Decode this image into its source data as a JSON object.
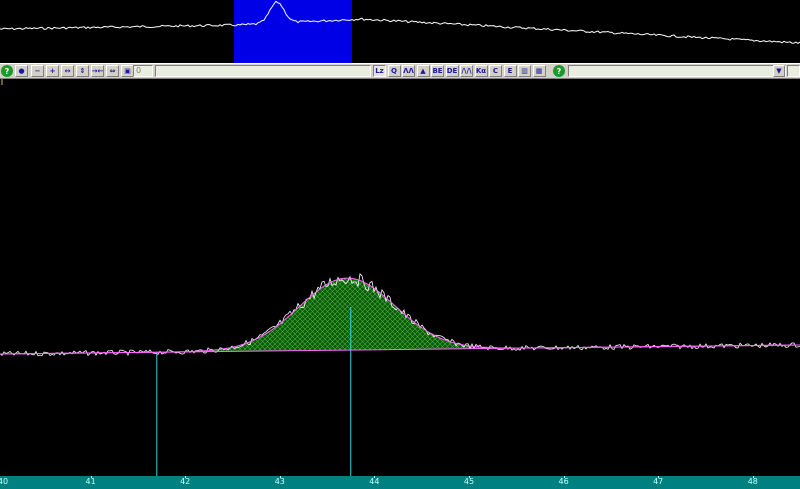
{
  "overview": {
    "selection_color": "#0000e6",
    "trace_color": "#ffffff"
  },
  "toolbar": {
    "help_glyph": "?",
    "stop_glyph": "●",
    "value_field": "0",
    "range_glyph": "▼",
    "buttons": [
      {
        "name": "minus-button",
        "glyph": "−"
      },
      {
        "name": "plus-button",
        "glyph": "+"
      },
      {
        "name": "zoom-x-out-button",
        "glyph": "↔"
      },
      {
        "name": "zoom-y-out-button",
        "glyph": "⇕"
      },
      {
        "name": "zoom-x-in-button",
        "glyph": "→←"
      },
      {
        "name": "zoom-y-in-button",
        "glyph": "⇔"
      },
      {
        "name": "full-view-button",
        "glyph": "▣"
      }
    ],
    "tools": [
      {
        "name": "cursor-tool-button",
        "glyph": "Lz"
      },
      {
        "name": "zoom-tool-button",
        "glyph": "Q"
      },
      {
        "name": "peak-tool-button",
        "glyph": "ΛΛ"
      },
      {
        "name": "area-tool-button",
        "glyph": "▲"
      },
      {
        "name": "be-tool-button",
        "glyph": "BE"
      },
      {
        "name": "de-tool-button",
        "glyph": "DE"
      },
      {
        "name": "fit-tool-button",
        "glyph": "/\\/\\"
      },
      {
        "name": "ka-tool-button",
        "glyph": "Kα"
      },
      {
        "name": "calibration-tool-button",
        "glyph": "C"
      },
      {
        "name": "energy-tool-button",
        "glyph": "E"
      },
      {
        "name": "histogram-tool-button",
        "glyph": "▥"
      },
      {
        "name": "grid-tool-button",
        "glyph": "▦"
      }
    ]
  },
  "spectrum": {
    "background_color": "#000000",
    "data_color": "#ffffff",
    "fit_color": "#ff66ff",
    "fill_color": "#0a5a0a",
    "hatch_color": "#4caf3a",
    "marker_color": "#40d0e0",
    "marker_positions": [
      41.7,
      43.75
    ]
  },
  "axis": {
    "color": "#008080",
    "label_color": "#c8ffff",
    "labels": [
      "40",
      "41",
      "42",
      "43",
      "44",
      "45",
      "46",
      "47",
      "48"
    ]
  }
}
